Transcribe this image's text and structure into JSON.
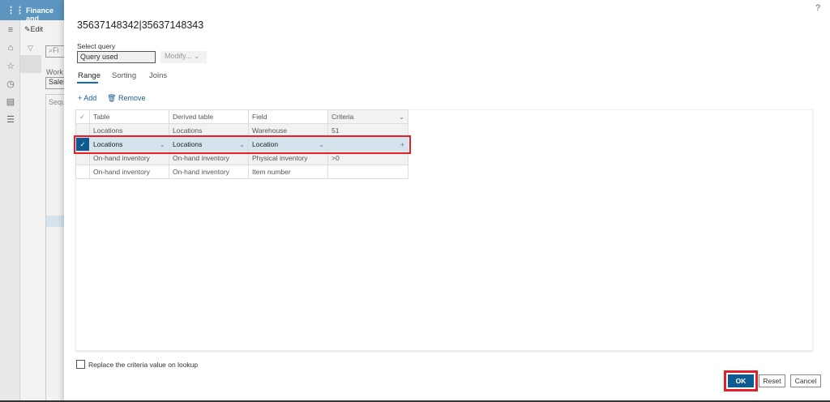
{
  "app": {
    "title": "Finance and",
    "edit_label": "Edit",
    "filter_placeholder": "Fi",
    "work_label": "Work",
    "work_value": "Sales",
    "seq_header": "Sequ"
  },
  "dialog": {
    "title": "35637148342|35637148343",
    "help": "?",
    "select_query_label": "Select query",
    "query_value": "Query used",
    "modify_label": "Modify...",
    "tabs": [
      {
        "label": "Range",
        "active": true
      },
      {
        "label": "Sorting"
      },
      {
        "label": "Joins"
      }
    ],
    "add_label": "Add",
    "remove_label": "Remove",
    "columns": [
      "Table",
      "Derived table",
      "Field",
      "Criteria"
    ],
    "rows": [
      {
        "table": "Locations",
        "derived": "Locations",
        "field": "Warehouse",
        "criteria": "51",
        "selected": false
      },
      {
        "table": "Locations",
        "derived": "Locations",
        "field": "Location",
        "criteria": "",
        "selected": true
      },
      {
        "table": "On-hand inventory",
        "derived": "On-hand inventory",
        "field": "Physical inventory",
        "criteria": ">0",
        "selected": false
      },
      {
        "table": "On-hand inventory",
        "derived": "On-hand inventory",
        "field": "Item number",
        "criteria": "",
        "selected": false
      }
    ],
    "replace_label": "Replace the criteria value on lookup",
    "replace_checked": false,
    "ok": "OK",
    "reset": "Reset",
    "cancel": "Cancel"
  },
  "colors": {
    "accent": "#0f6cbd",
    "highlight": "#e0202a",
    "topbar": "#5b95c0"
  }
}
